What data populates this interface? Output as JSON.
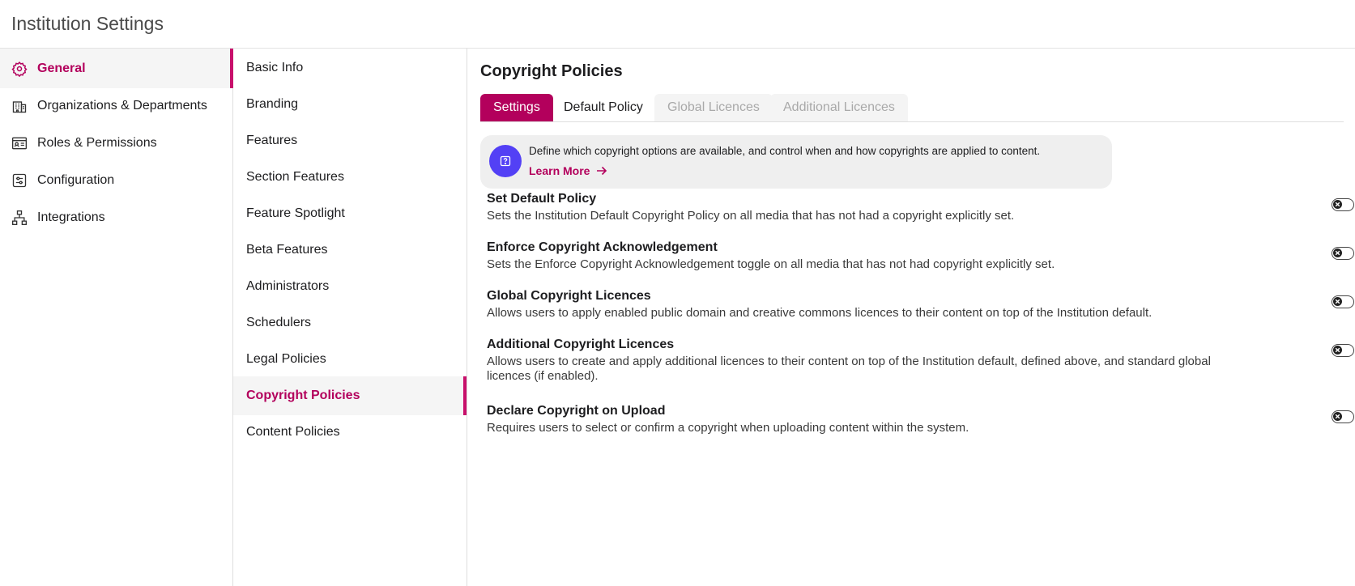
{
  "header": {
    "title": "Institution Settings"
  },
  "sidebar": {
    "items": [
      {
        "label": "General",
        "icon": "gear-icon",
        "active": true
      },
      {
        "label": "Organizations & Departments",
        "icon": "building-icon",
        "active": false
      },
      {
        "label": "Roles & Permissions",
        "icon": "id-card-icon",
        "active": false
      },
      {
        "label": "Configuration",
        "icon": "sliders-icon",
        "active": false
      },
      {
        "label": "Integrations",
        "icon": "network-icon",
        "active": false
      }
    ]
  },
  "subnav": {
    "items": [
      {
        "label": "Basic Info",
        "active": false
      },
      {
        "label": "Branding",
        "active": false
      },
      {
        "label": "Features",
        "active": false
      },
      {
        "label": "Section Features",
        "active": false
      },
      {
        "label": "Feature Spotlight",
        "active": false
      },
      {
        "label": "Beta Features",
        "active": false
      },
      {
        "label": "Administrators",
        "active": false
      },
      {
        "label": "Schedulers",
        "active": false
      },
      {
        "label": "Legal Policies",
        "active": false
      },
      {
        "label": "Copyright Policies",
        "active": true
      },
      {
        "label": "Content Policies",
        "active": false
      }
    ]
  },
  "main": {
    "title": "Copyright Policies",
    "tabs": [
      {
        "label": "Settings",
        "state": "active"
      },
      {
        "label": "Default Policy",
        "state": "normal"
      },
      {
        "label": "Global Licences",
        "state": "disabled"
      },
      {
        "label": "Additional Licences",
        "state": "disabled"
      }
    ],
    "info": {
      "text": "Define which copyright options are available, and control when and how copyrights are applied to content.",
      "link": "Learn More",
      "icon": "help-icon"
    },
    "settings": [
      {
        "title": "Set Default Policy",
        "description": "Sets the Institution Default Copyright Policy on all media that has not had a copyright explicitly set.",
        "enabled": false
      },
      {
        "title": "Enforce Copyright Acknowledgement",
        "description": "Sets the Enforce Copyright Acknowledgement toggle on all media that has not had copyright explicitly set.",
        "enabled": false
      },
      {
        "title": "Global Copyright Licences",
        "description": "Allows users to apply enabled public domain and creative commons licences to their content on top of the Institution default.",
        "enabled": false
      },
      {
        "title": "Additional Copyright Licences",
        "description": "Allows users to create and apply additional licences to their content on top of the Institution default, defined above, and standard global licences (if enabled).",
        "enabled": false
      },
      {
        "title": "Declare Copyright on Upload",
        "description": "Requires users to select or confirm a copyright when uploading content within the system.",
        "enabled": false
      }
    ]
  },
  "colors": {
    "accent": "#b3005c",
    "info_icon_bg": "#5340f5",
    "info_box_bg": "#efefef"
  }
}
